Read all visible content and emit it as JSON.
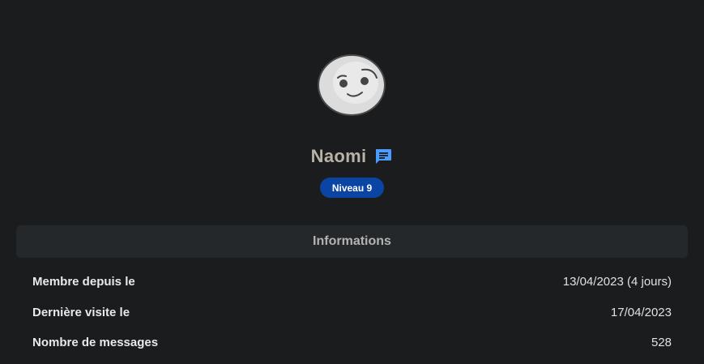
{
  "profile": {
    "username": "Naomi",
    "level_badge": "Niveau 9",
    "avatar_icon": "smiling-face-avatar",
    "message_icon": "chat-bubble-icon",
    "accent_color": "#4a9dff",
    "badge_color": "#0b45a3"
  },
  "informations": {
    "title": "Informations",
    "rows": [
      {
        "label": "Membre depuis le",
        "value": "13/04/2023 (4 jours)"
      },
      {
        "label": "Dernière visite le",
        "value": "17/04/2023"
      },
      {
        "label": "Nombre de messages",
        "value": "528"
      }
    ]
  }
}
